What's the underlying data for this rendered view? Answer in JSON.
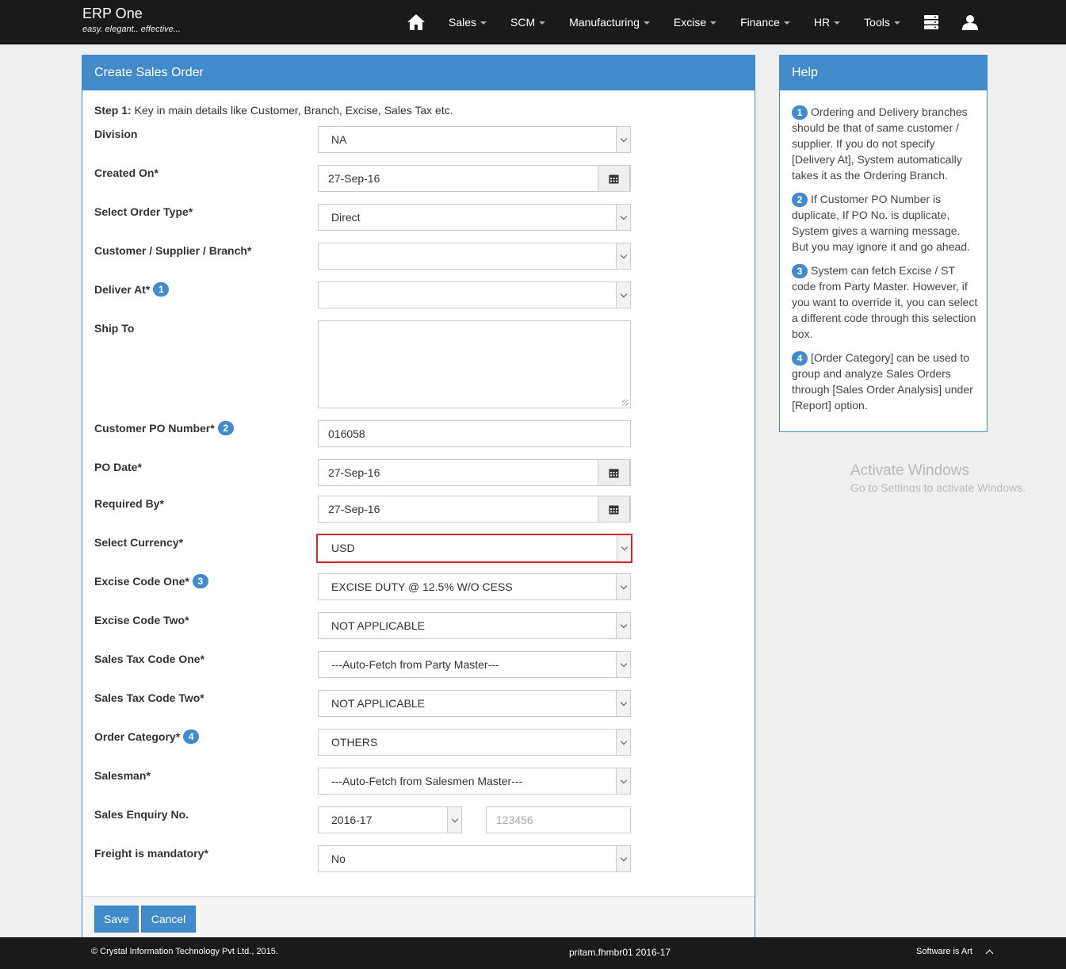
{
  "app": {
    "title": "ERP One",
    "tagline": "easy. elegant.. effective..."
  },
  "nav": {
    "home_icon": "home-icon",
    "items": [
      "Sales",
      "SCM",
      "Manufacturing",
      "Excise",
      "Finance",
      "HR",
      "Tools"
    ],
    "db_icon": "database-icon",
    "user_icon": "user-icon"
  },
  "form": {
    "title": "Create Sales Order",
    "step_label": "Step 1:",
    "step_text": " Key in main details like Customer, Branch, Excise, Sales Tax etc.",
    "fields": {
      "division": {
        "label": "Division",
        "value": "NA"
      },
      "created_on": {
        "label": "Created On*",
        "value": "27-Sep-16"
      },
      "order_type": {
        "label": "Select Order Type*",
        "value": "Direct"
      },
      "customer": {
        "label": "Customer / Supplier / Branch*",
        "value": ""
      },
      "deliver_at": {
        "label": "Deliver At*",
        "badge": "1",
        "value": ""
      },
      "ship_to": {
        "label": "Ship To",
        "value": ""
      },
      "customer_po": {
        "label": "Customer PO Number*",
        "badge": "2",
        "value": "016058"
      },
      "po_date": {
        "label": "PO Date*",
        "value": "27-Sep-16"
      },
      "required_by": {
        "label": "Required By*",
        "value": "27-Sep-16"
      },
      "currency": {
        "label": "Select Currency*",
        "value": "USD"
      },
      "excise_one": {
        "label": "Excise Code One*",
        "badge": "3",
        "value": "EXCISE DUTY @ 12.5% W/O CESS"
      },
      "excise_two": {
        "label": "Excise Code Two*",
        "value": "NOT APPLICABLE"
      },
      "sales_tax_one": {
        "label": "Sales Tax Code One*",
        "value": "---Auto-Fetch from Party Master---"
      },
      "sales_tax_two": {
        "label": "Sales Tax Code Two*",
        "value": "NOT APPLICABLE"
      },
      "order_category": {
        "label": "Order Category*",
        "badge": "4",
        "value": "OTHERS"
      },
      "salesman": {
        "label": "Salesman*",
        "value": "---Auto-Fetch from Salesmen Master---"
      },
      "sales_enquiry": {
        "label": "Sales Enquiry No.",
        "year": "2016-17",
        "placeholder": "123456"
      },
      "freight": {
        "label": "Freight is mandatory*",
        "value": "No"
      }
    },
    "save_label": "Save",
    "cancel_label": "Cancel"
  },
  "help": {
    "title": "Help",
    "items": [
      {
        "num": "1",
        "text": "Ordering and Delivery branches should be that of same customer / supplier. If you do not specify [Delivery At], System automatically takes it as the Ordering Branch."
      },
      {
        "num": "2",
        "text": "If Customer PO Number is duplicate, If PO No. is duplicate, System gives a warning message. But you may ignore it and go ahead."
      },
      {
        "num": "3",
        "text": "System can fetch Excise / ST code from Party Master. However, if you want to override it, you can select a different code through this selection box."
      },
      {
        "num": "4",
        "text": "[Order Category] can be used to group and analyze Sales Orders through [Sales Order Analysis] under [Report] option."
      }
    ]
  },
  "watermark": {
    "line1": "Activate Windows",
    "line2": "Go to Settings to activate Windows."
  },
  "footer": {
    "copyright": "© Crystal Information Technology Pvt Ltd., 2015.",
    "session": "pritam.fhmbr01 2016-17",
    "slogan": "Software is Art"
  },
  "colors": {
    "primary": "#428bca",
    "highlight": "#d9252a",
    "navbar": "#1a1a1a"
  }
}
